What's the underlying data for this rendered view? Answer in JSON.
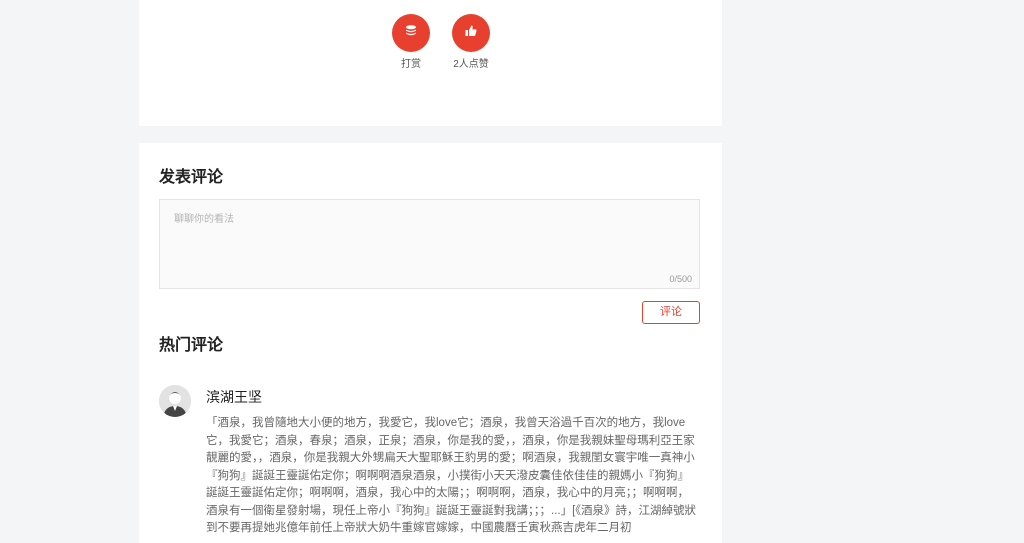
{
  "actions": {
    "tip_label": "打赏",
    "like_label": "2人点赞",
    "accent": "#e8402f"
  },
  "comment_form": {
    "title": "发表评论",
    "placeholder": "聊聊你的看法",
    "counter": "0/500",
    "submit_label": "评论"
  },
  "hot_comments": {
    "title": "热门评论",
    "items": [
      {
        "author": "滨湖王坚",
        "text": "「酒泉，我曾隨地大小便的地方，我愛它，我love它；酒泉，我曾天浴過千百次的地方，我love它，我愛它；酒泉，春泉；酒泉，正泉；酒泉，你是我的愛，，酒泉，你是我親妹聖母瑪利亞王家靚麗的愛，，酒泉，你是我親大外甥扁天大聖耶穌王豹男的愛；啊酒泉，我親閨女寰宇唯一真神小『狗狗』誕誕王靈誕佑定你；啊啊啊酒泉酒泉，小撲街小天天潑皮囊佳依佳佳的親媽小『狗狗』誕誕王靈誕佑定你；啊啊啊，酒泉，我心中的太陽；；啊啊啊，酒泉，我心中的月亮；；啊啊啊，酒泉有一個衛星發射場，現任上帝小『狗狗』誕誕王靈誕對我講；；；...」[《酒泉》詩，江湖綽號狀到不要再提她兆億年前任上帝狀大奶牛重嫁官嫁嫁，中國農曆壬寅秋燕吉虎年二月初"
      }
    ]
  }
}
